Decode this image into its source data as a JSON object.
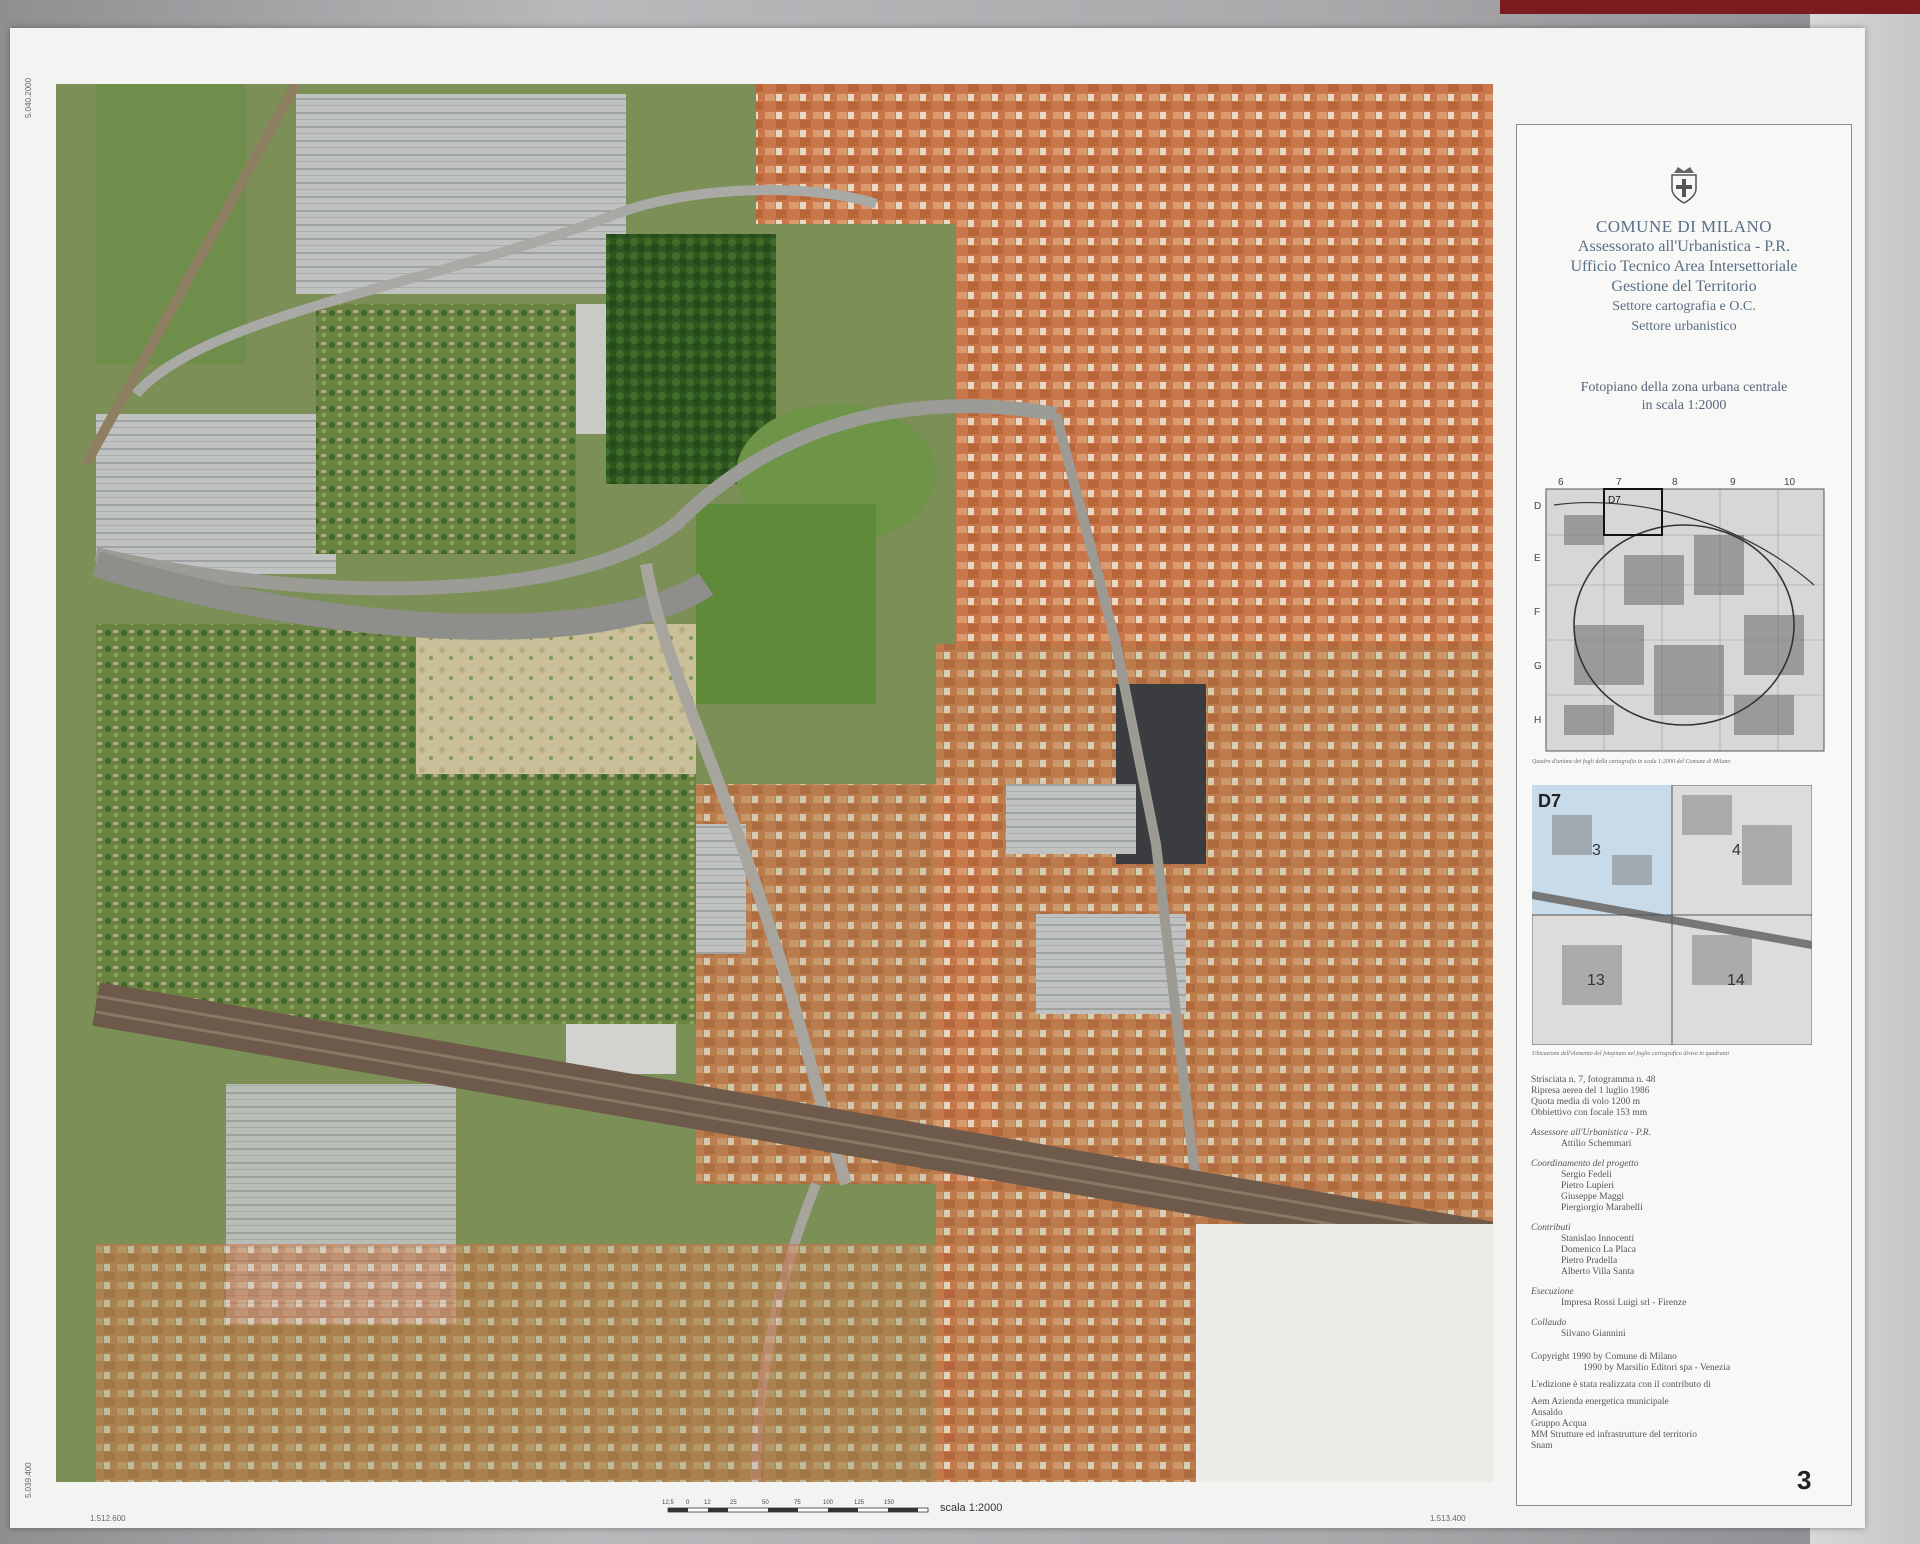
{
  "coords": {
    "top_left_vertical": "5.040.2000",
    "left_bottom_vertical": "5.039.400",
    "bottom_left": "1.512.600",
    "bottom_right": "1.513.400"
  },
  "scale": {
    "ticks": [
      "12,5",
      "0",
      "12",
      "25",
      "50",
      "75",
      "100",
      "125",
      "150"
    ],
    "label": "scala 1:2000"
  },
  "legend": {
    "org_line1": "COMUNE DI MILANO",
    "org_line2": "Assessorato all'Urbanistica - P.R.",
    "org_line3": "Ufficio Tecnico Area Intersettoriale",
    "org_line4": "Gestione del Territorio",
    "org_line5": "Settore cartografia e O.C.",
    "org_line6": "Settore urbanistico",
    "subtitle_line1": "Fotopiano della zona urbana centrale",
    "subtitle_line2": "in scala 1:2000",
    "index_cols": [
      "6",
      "7",
      "8",
      "9",
      "10"
    ],
    "index_rows": [
      "D",
      "E",
      "F",
      "G",
      "H"
    ],
    "index_cell": "D7",
    "index_caption": "Quadro d'unione dei fogli della cartografia in scala 1:2000 del Comune di Milano",
    "loc_title": "D7",
    "loc_quadrants": [
      "3",
      "4",
      "13",
      "14"
    ],
    "loc_caption": "Ubicazione dell'elemento del fotopiano nel foglio cartografico diviso in quadranti",
    "flight": [
      "Strisciata n. 7, fotogramma n. 48",
      "Ripresa aerea del 1 luglio 1986",
      "Quota media di volo 1200 m",
      "Obbiettivo con focale 153 mm"
    ],
    "assessore_h": "Assessore all'Urbanistica - P.R.",
    "assessore": "Attilio Schemmari",
    "coord_h": "Coordinamento del progetto",
    "coord_names": [
      "Sergio Fedeli",
      "Pietro Lupieri",
      "Giuseppe Maggi",
      "Piergiorgio Marabelli"
    ],
    "contrib_h": "Contributi",
    "contrib_names": [
      "Stanislao Innocenti",
      "Domenico La Placa",
      "Pietro Pradella",
      "Alberto Villa Santa"
    ],
    "esec_h": "Esecuzione",
    "esec": "Impresa Rossi Luigi srl - Firenze",
    "coll_h": "Collaudo",
    "coll": "Silvano Giannini",
    "copyright1": "Copyright   1990 by Comune di Milano",
    "copyright2": "1990 by Marsilio Editori spa - Venezia",
    "edition": "L'edizione è stata realizzata con il contributo di",
    "sponsors": [
      "Aem Azienda energetica municipale",
      "Ansaldo",
      "Gruppo Acqua",
      "MM Strutture ed infrastrutture del territorio",
      "Snam"
    ],
    "sheet_number": "3"
  },
  "colors": {
    "title_blue": "#5a6f86",
    "roof_orange": "#c8743f",
    "vegetation": "#4f7a2f"
  }
}
